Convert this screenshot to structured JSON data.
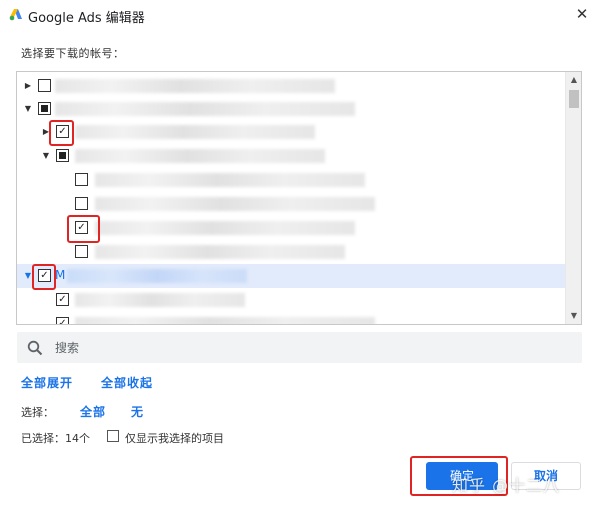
{
  "window": {
    "title": "Google Ads 编辑器",
    "close_icon": "close-icon",
    "logo_icon": "google-ads-logo-icon",
    "logo_colors": [
      "#fbbc04",
      "#4285f4",
      "#34a853"
    ]
  },
  "dialog": {
    "prompt": "选择要下载的帐号：",
    "selected_row_letter": "M"
  },
  "tree": {
    "rows": [
      {
        "expander": "collapsed",
        "checkbox": "unchecked"
      },
      {
        "expander": "expanded",
        "checkbox": "partial"
      },
      {
        "expander": "collapsed",
        "checkbox": "checked",
        "highlighted": true
      },
      {
        "expander": "expanded",
        "checkbox": "partial"
      },
      {
        "expander": "none",
        "checkbox": "unchecked"
      },
      {
        "expander": "none",
        "checkbox": "unchecked"
      },
      {
        "expander": "none",
        "checkbox": "checked",
        "highlighted": true
      },
      {
        "expander": "none",
        "checkbox": "unchecked"
      },
      {
        "expander": "expanded",
        "checkbox": "checked",
        "highlighted": true,
        "selected": true
      },
      {
        "expander": "none",
        "checkbox": "checked"
      },
      {
        "expander": "none",
        "checkbox": "checked"
      }
    ]
  },
  "search": {
    "placeholder": "搜索",
    "icon": "search-icon"
  },
  "actions": {
    "expand_all": "全部展开",
    "collapse_all": "全部收起"
  },
  "selection": {
    "label": "选择：",
    "all": "全部",
    "none": "无",
    "selected_count": "已选择：14个",
    "show_only_selected": "仅显示我选择的项目"
  },
  "buttons": {
    "ok": "确定",
    "cancel": "取消"
  },
  "watermark": "知乎 @十二八",
  "colors": {
    "accent": "#1a73e8",
    "highlight_border": "#e02424",
    "selected_row": "#e2ebfb"
  }
}
